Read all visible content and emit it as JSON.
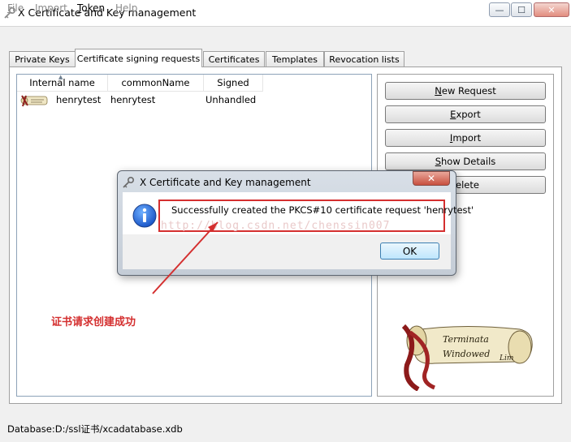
{
  "window": {
    "title": "X Certificate and Key management",
    "minimize_symbol": "—",
    "maximize_symbol": "☐",
    "close_symbol": "✕"
  },
  "menu": {
    "items": [
      {
        "label": "File",
        "enabled": false
      },
      {
        "label": "Import",
        "enabled": false
      },
      {
        "label": "Token",
        "enabled": true
      },
      {
        "label": "Help",
        "enabled": false
      }
    ]
  },
  "tabs": [
    {
      "label": "Private Keys"
    },
    {
      "label": "Certificate signing requests",
      "active": true
    },
    {
      "label": "Certificates"
    },
    {
      "label": "Templates"
    },
    {
      "label": "Revocation lists"
    }
  ],
  "list": {
    "columns": [
      "Internal name",
      "commonName",
      "Signed"
    ],
    "rows": [
      {
        "internal_name": "henrytest",
        "common_name": "henrytest",
        "signed": "Unhandled"
      }
    ]
  },
  "actions": {
    "new_request": "New Request",
    "export": "Export",
    "import": "Import",
    "show_details": "Show Details",
    "delete": "elete"
  },
  "scroll_art": {
    "line1": "Terminata",
    "line2": "Windowed",
    "signature": "Lim"
  },
  "status": {
    "text": "Database:D:/ssl证书/xcadatabase.xdb"
  },
  "dialog": {
    "title": "X Certificate and Key management",
    "close_symbol": "✕",
    "message": "Successfully created the PKCS#10 certificate request 'henrytest'",
    "watermark": "http://blog.csdn.net/chenssin007",
    "ok_label": "OK"
  },
  "annotation": {
    "text": "证书请求创建成功",
    "color": "#d42f2f"
  }
}
